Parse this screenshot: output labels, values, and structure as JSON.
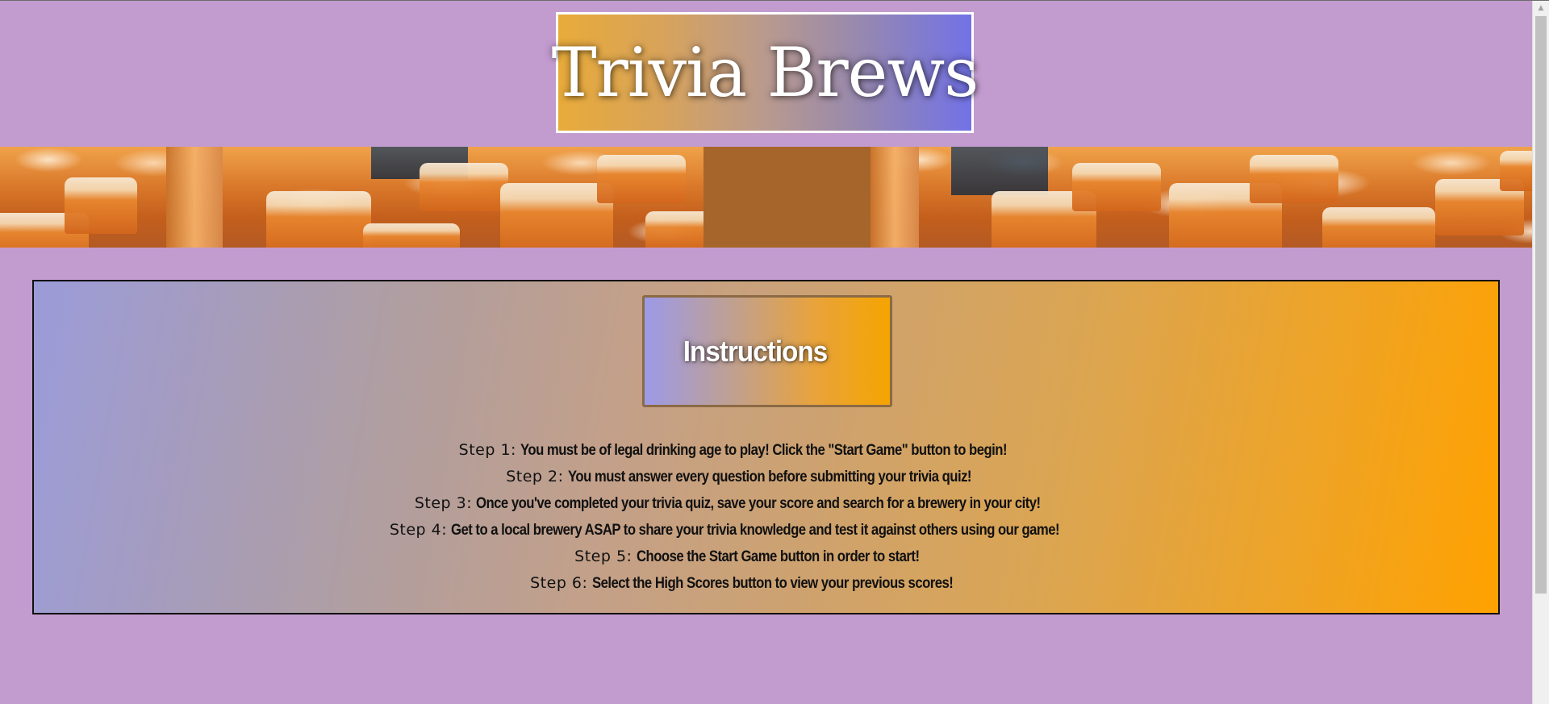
{
  "header": {
    "title": "Trivia Brews"
  },
  "banner": {
    "image": "beer-flight-photo"
  },
  "instructions": {
    "heading": "Instructions",
    "steps": [
      {
        "label": "Step 1:",
        "text": "You must be of legal drinking age to play! Click the \"Start Game\" button to begin!"
      },
      {
        "label": "Step 2:",
        "text": "You must answer every question before submitting your trivia quiz!"
      },
      {
        "label": "Step 3:",
        "text": "Once you've completed your trivia quiz, save your score and search for a brewery in your city!"
      },
      {
        "label": "Step 4:",
        "text": "Get to a local brewery ASAP to share your trivia knowledge and test it against others using our game!"
      },
      {
        "label": "Step 5:",
        "text": "Choose the Start Game button in order to start!"
      },
      {
        "label": "Step 6:",
        "text": "Select the High Scores button to view your previous scores!"
      }
    ]
  },
  "colors": {
    "page_background": "#c39ccf",
    "title_gradient_start": "#e8ab3a",
    "title_gradient_end": "#7272e6",
    "panel_gradient_start": "#9b9bd9",
    "panel_gradient_end": "#ffa200"
  },
  "scrollbar": {
    "up_arrow_icon": "scroll-up-arrow-icon"
  }
}
